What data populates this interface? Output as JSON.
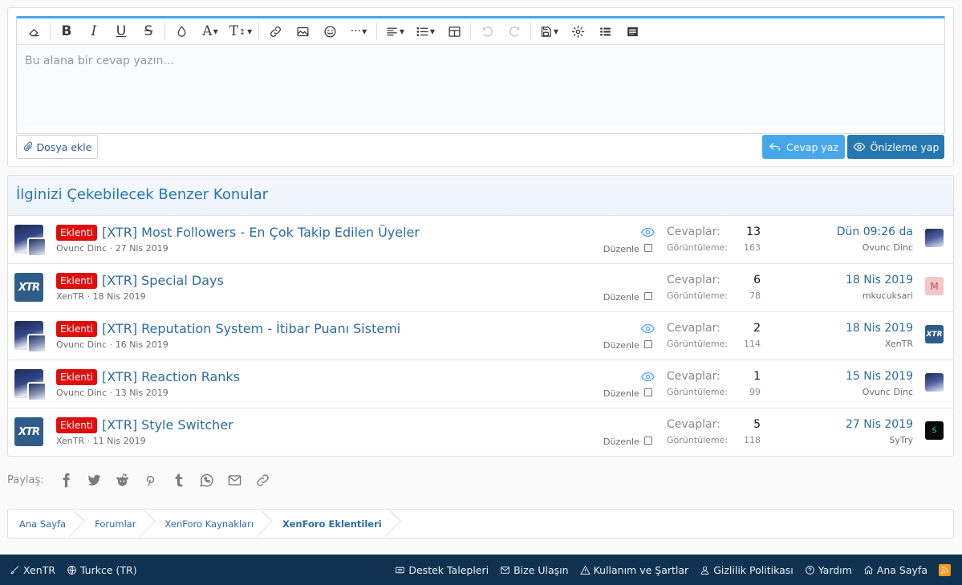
{
  "editor": {
    "placeholder": "Bu alana bir cevap yazın...",
    "attach_label": "Dosya ekle",
    "reply_label": "Cevap yaz",
    "preview_label": "Önizleme yap",
    "accent": "#47a7eb"
  },
  "similar": {
    "title": "İlginizi Çekebilecek Benzer Konular",
    "replies_label": "Cevaplar:",
    "views_label": "Görüntüleme:",
    "edit_label": "Düzenle",
    "threads": [
      {
        "label": "Eklenti",
        "title": "[XTR] Most Followers - En Çok Takip Edilen Üyeler",
        "author": "Ovunc Dinc",
        "date": "27 Nis 2019",
        "replies": "13",
        "views": "163",
        "last_date": "Dün 09:26 da",
        "last_user": "Ovunc Dinc",
        "watched": true,
        "avatar": "anime",
        "last_avatar": "anime",
        "last_avatar_text": ""
      },
      {
        "label": "Eklenti",
        "title": "[XTR] Special Days",
        "author": "XenTR",
        "date": "18 Nis 2019",
        "replies": "6",
        "views": "78",
        "last_date": "18 Nis 2019",
        "last_user": "mkucuksari",
        "watched": false,
        "avatar": "xtr",
        "last_avatar": "letter",
        "last_avatar_text": "M"
      },
      {
        "label": "Eklenti",
        "title": "[XTR] Reputation System - İtibar Puanı Sistemi",
        "author": "Ovunc Dinc",
        "date": "16 Nis 2019",
        "replies": "2",
        "views": "114",
        "last_date": "18 Nis 2019",
        "last_user": "XenTR",
        "watched": true,
        "avatar": "anime",
        "last_avatar": "xtr",
        "last_avatar_text": "XTR"
      },
      {
        "label": "Eklenti",
        "title": "[XTR] Reaction Ranks",
        "author": "Ovunc Dinc",
        "date": "13 Nis 2019",
        "replies": "1",
        "views": "99",
        "last_date": "15 Nis 2019",
        "last_user": "Ovunc Dinc",
        "watched": true,
        "avatar": "anime",
        "last_avatar": "anime",
        "last_avatar_text": ""
      },
      {
        "label": "Eklenti",
        "title": "[XTR] Style Switcher",
        "author": "XenTR",
        "date": "11 Nis 2019",
        "replies": "5",
        "views": "118",
        "last_date": "27 Nis 2019",
        "last_user": "SyTry",
        "watched": false,
        "avatar": "xtr",
        "last_avatar": "dark",
        "last_avatar_text": "S"
      }
    ]
  },
  "share": {
    "label": "Paylaş:",
    "icons": [
      "facebook-icon",
      "twitter-icon",
      "reddit-icon",
      "pinterest-icon",
      "tumblr-icon",
      "whatsapp-icon",
      "email-icon",
      "link-icon"
    ]
  },
  "breadcrumb": [
    "Ana Sayfa",
    "Forumlar",
    "XenForo Kaynakları",
    "XenForo Eklentileri"
  ],
  "footer": {
    "left": [
      "XenTR",
      "Turkce (TR)"
    ],
    "right": [
      "Destek Talepleri",
      "Bize Ulaşın",
      "Kullanım ve Şartlar",
      "Gizlilik Politikası",
      "Yardım",
      "Ana Sayfa"
    ]
  },
  "avatar_text": {
    "xtr": "XTR"
  }
}
